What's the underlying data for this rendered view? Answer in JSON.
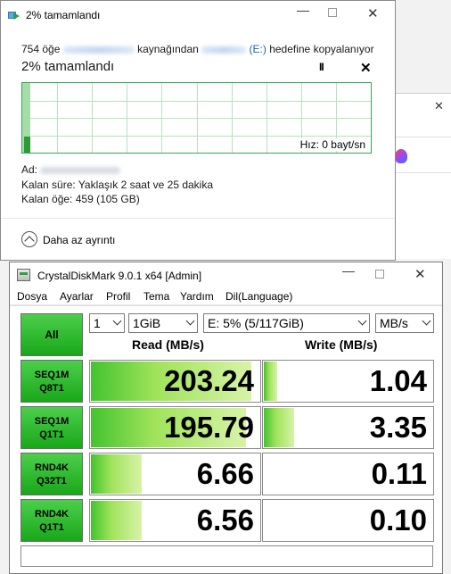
{
  "copy_dialog": {
    "title": "2% tamamlandı",
    "description_prefix": "754 öğe",
    "description_mid": "kaynağından",
    "description_drive": "(E:)",
    "description_suffix": "hedefine kopyalanıyor",
    "progress_heading": "2%  tamamlandı",
    "pause_symbol": "II",
    "cancel_symbol": "✕",
    "speed_text": "Hız: 0 bayt/sn",
    "progress_fraction": 0.02,
    "name_label": "Ad:",
    "time_left": "Kalan süre:  Yaklaşık 2 saat ve 25 dakika",
    "items_left": "Kalan öğe:  459 (105 GB)",
    "less_details": "Daha az ayrıntı"
  },
  "cdm": {
    "title": "CrystalDiskMark 9.0.1 x64 [Admin]",
    "menu": [
      "Dosya",
      "Ayarlar",
      "Profil",
      "Tema",
      "Yardım",
      "Dil(Language)"
    ],
    "all_button": "All",
    "count_select": "1",
    "size_select": "1GiB",
    "drive_select": "E: 5% (5/117GiB)",
    "unit_select": "MB/s",
    "read_header": "Read (MB/s)",
    "write_header": "Write (MB/s)",
    "tests": [
      {
        "line1": "SEQ1M",
        "line2": "Q8T1",
        "read": "203.24",
        "write": "1.04",
        "read_fill": 0.95,
        "write_fill": 0.08
      },
      {
        "line1": "SEQ1M",
        "line2": "Q1T1",
        "read": "195.79",
        "write": "3.35",
        "read_fill": 0.92,
        "write_fill": 0.18
      },
      {
        "line1": "RND4K",
        "line2": "Q32T1",
        "read": "6.66",
        "write": "0.11",
        "read_fill": 0.3,
        "write_fill": 0.0
      },
      {
        "line1": "RND4K",
        "line2": "Q1T1",
        "read": "6.56",
        "write": "0.10",
        "read_fill": 0.3,
        "write_fill": 0.0
      }
    ]
  },
  "colors": {
    "accent_green": "#19a719",
    "graph_green": "#34a853",
    "link_blue": "#1d64b3"
  }
}
